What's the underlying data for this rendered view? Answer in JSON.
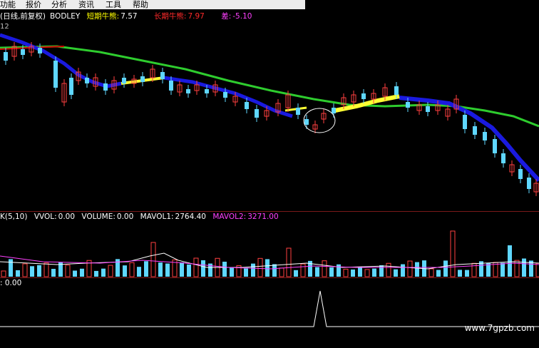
{
  "menu": {
    "items": [
      "功能",
      "报价",
      "分析",
      "资讯",
      "工具",
      "帮助"
    ]
  },
  "main": {
    "title": "(日线,前复权)",
    "indicator": "BODLEY",
    "short_label": "短期牛熊:",
    "short_value": "7.57",
    "long_label": "长期牛熊:",
    "long_value": "7.97",
    "diff_label": "差:",
    "diff_value": "-5.10",
    "price_tick": "12",
    "colors": {
      "short_label": "#ffff00",
      "long_label": "#ff2a2a",
      "diff": "#ff40ff",
      "green_line": "#2ecc2e",
      "blue_band": "#1a1adf",
      "red_line": "#d00000",
      "yellow": "#ffff33",
      "up_candle": "#ff4040",
      "down_candle": "#5fd7ff"
    }
  },
  "volume": {
    "title": "K(5,10)",
    "vvol_label": "VVOL:",
    "vvol_value": "0.00",
    "volume_label": "VOLUME:",
    "volume_value": "0.00",
    "mavol1_label": "MAVOL1:",
    "mavol1_value": "2764.40",
    "mavol2_label": "MAVOL2:",
    "mavol2_value": "3271.00",
    "colors": {
      "mavol2": "#ff40ff",
      "up": "#ff4040",
      "down": "#5fd7ff"
    }
  },
  "indicator_panel": {
    "label": ": 0.00",
    "watermark": "www.7gpzb.com"
  }
}
